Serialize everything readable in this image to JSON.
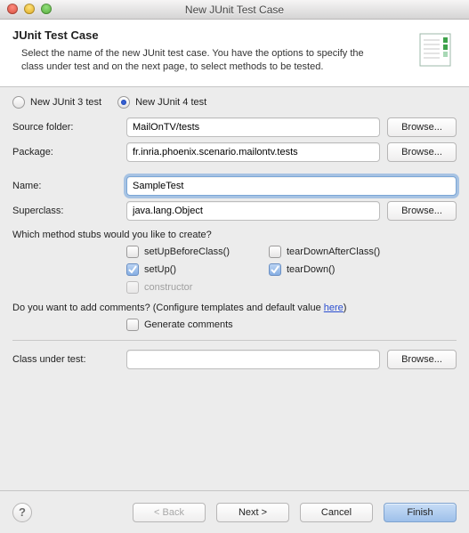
{
  "window": {
    "title": "New JUnit Test Case"
  },
  "header": {
    "title": "JUnit Test Case",
    "desc": "Select the name of the new JUnit test case. You have the options to specify the class under test and on the next page, to select methods to be tested."
  },
  "radios": {
    "junit3": "New JUnit 3 test",
    "junit4": "New JUnit 4 test",
    "selected": "junit4"
  },
  "labels": {
    "sourceFolder": "Source folder:",
    "package": "Package:",
    "name": "Name:",
    "superclass": "Superclass:",
    "classUnderTest": "Class under test:"
  },
  "values": {
    "sourceFolder": "MailOnTV/tests",
    "package": "fr.inria.phoenix.scenario.mailontv.tests",
    "name": "SampleTest",
    "superclass": "java.lang.Object",
    "classUnderTest": ""
  },
  "stubs": {
    "question": "Which method stubs would you like to create?",
    "setUpBeforeClass": {
      "label": "setUpBeforeClass()",
      "checked": false
    },
    "tearDownAfterClass": {
      "label": "tearDownAfterClass()",
      "checked": false
    },
    "setUp": {
      "label": "setUp()",
      "checked": true
    },
    "tearDown": {
      "label": "tearDown()",
      "checked": true
    },
    "constructor": {
      "label": "constructor",
      "checked": false,
      "disabled": true
    }
  },
  "comments": {
    "prefix": "Do you want to add comments? (Configure templates and default value ",
    "link": "here",
    "suffix": ")",
    "generate": {
      "label": "Generate comments",
      "checked": false
    }
  },
  "buttons": {
    "browse": "Browse...",
    "back": "< Back",
    "next": "Next >",
    "cancel": "Cancel",
    "finish": "Finish"
  }
}
